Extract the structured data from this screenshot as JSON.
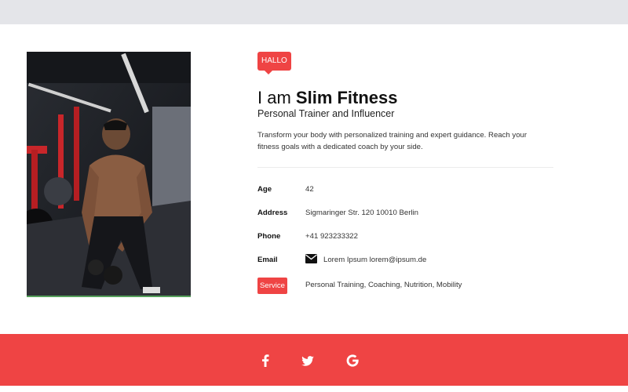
{
  "profile": {
    "badge": "HALLO",
    "greeting": "I am",
    "name": "Slim Fitness",
    "subtitle": "Personal Trainer and Influencer",
    "description": "Transform your body with personalized training and expert guidance. Reach your fitness goals with a dedicated coach by your side.",
    "photo_icon": "trainer-photo"
  },
  "details": {
    "age_label": "Age",
    "age_value": "42",
    "address_label": "Address",
    "address_value": "Sigmaringer Str. 120 10010 Berlin",
    "phone_label": "Phone",
    "phone_value": "+41 923233322",
    "email_label": "Email",
    "email_value": "Lorem Ipsum lorem@ipsum.de",
    "email_icon": "envelope-icon",
    "service_label": "Service",
    "service_value": "Personal Training, Coaching, Nutrition, Mobility"
  },
  "footer": {
    "social": [
      "facebook-icon",
      "twitter-icon",
      "google-icon"
    ]
  },
  "colors": {
    "accent": "#ef4444",
    "topbar": "#e4e5e9"
  }
}
